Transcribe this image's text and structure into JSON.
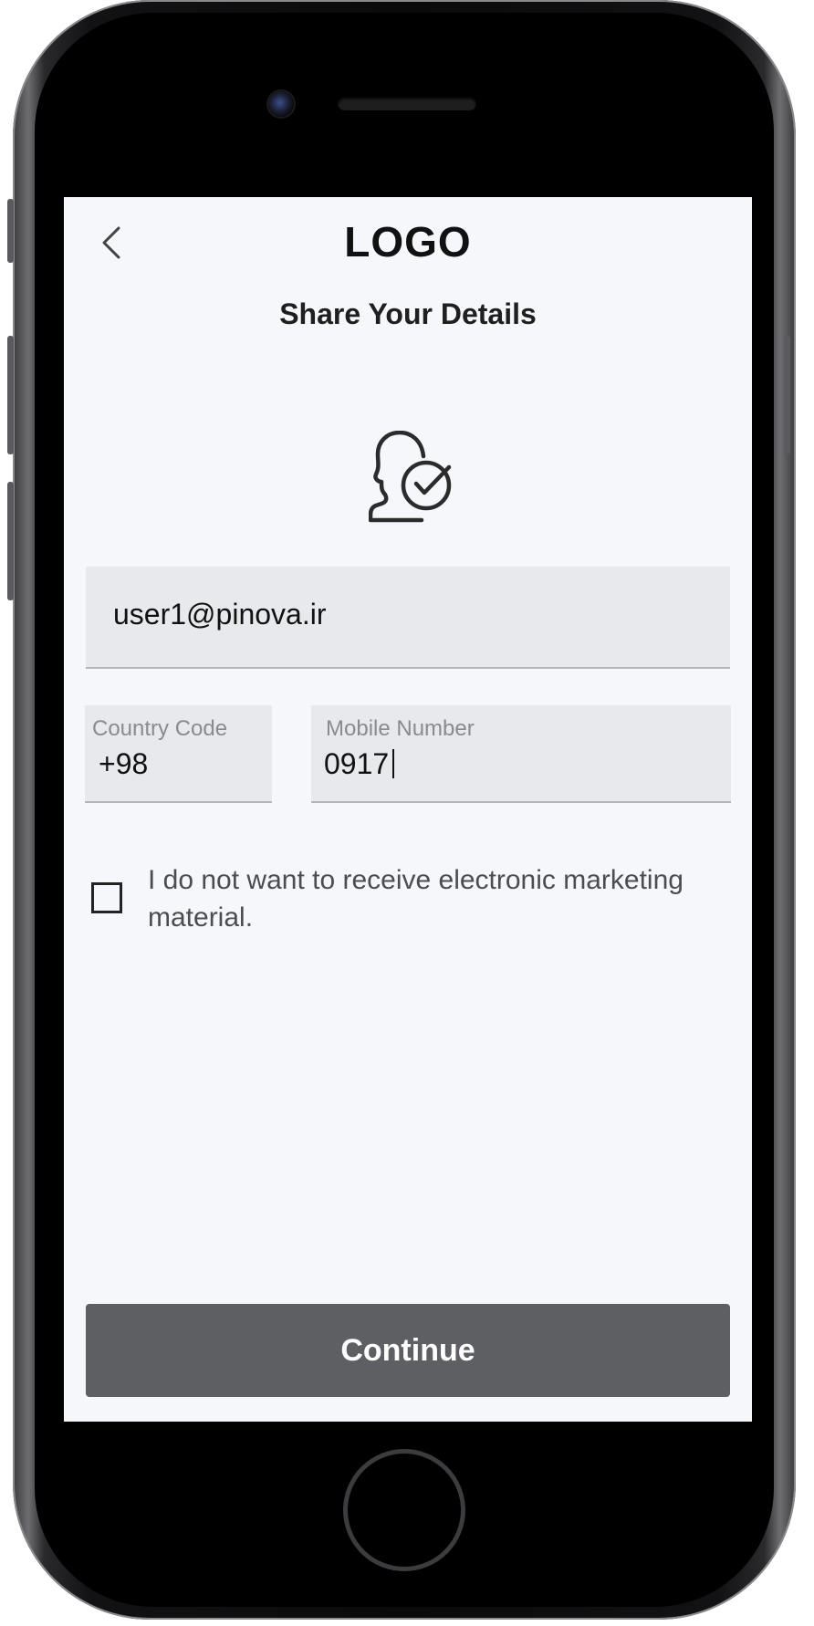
{
  "header": {
    "logo_text": "LOGO",
    "title": "Share Your Details"
  },
  "icons": {
    "back": "chevron-left-icon",
    "hero": "user-check-icon",
    "checkbox": "checkbox-icon"
  },
  "form": {
    "email": {
      "value": "user1@pinova.ir"
    },
    "country_code": {
      "label": "Country Code",
      "value": "+98"
    },
    "mobile": {
      "label": "Mobile Number",
      "value": "0917"
    },
    "marketing_opt_out": {
      "label": "I do not want to receive electronic marketing material.",
      "checked": false
    }
  },
  "actions": {
    "continue_label": "Continue"
  },
  "colors": {
    "screen_bg": "#f6f7fb",
    "field_bg": "#e8e9ed",
    "button_bg": "#5e5f62",
    "button_text": "#ffffff"
  }
}
